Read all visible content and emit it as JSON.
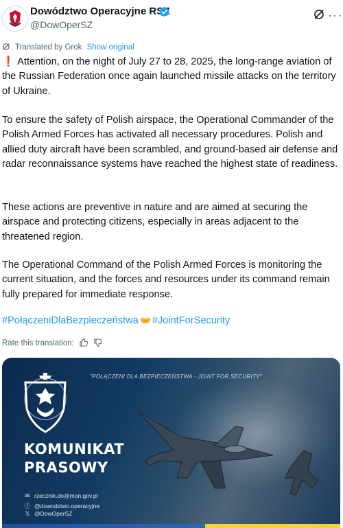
{
  "author": {
    "display_name": "Dowództwo Operacyjne RSZ",
    "handle": "@DowOperSZ"
  },
  "translation": {
    "label": "Translated by Grok",
    "show_original": "Show original"
  },
  "tweet": {
    "paragraphs": [
      "Attention, on the night of July 27 to 28, 2025, the long-range aviation of the Russian Federation once again launched missile attacks on the territory of Ukraine.",
      "To ensure the safety of Polish airspace, the Operational Commander of the Polish Armed Forces has activated all necessary procedures. Polish and allied duty aircraft have been scrambled, and ground-based air defense and radar reconnaissance systems have reached the highest state of readiness.",
      "These actions are preventive in nature and are aimed at securing the airspace and protecting citizens, especially in areas adjacent to the threatened region.",
      "The Operational Command of the Polish Armed Forces is monitoring the current situation, and the forces and resources under its command remain fully prepared for immediate response."
    ],
    "hashtag_1": "#PołączeniDlaBezpieczeństwa",
    "hashtag_2": "#JointForSecurity"
  },
  "rate": {
    "label": "Rate this translation:"
  },
  "media": {
    "slogan": "\"POŁĄCZENI DLA BEZPIECZEŃSTWA - JOINT FOR SECURITY\"",
    "title_line1": "KOMUNIKAT",
    "title_line2": "PRASOWY",
    "contact_email": "rzecznik.do@mon.gov.pl",
    "contact_facebook": "@dowodztwo.operacyjne",
    "contact_x": "@DowOperSZ"
  },
  "colors": {
    "link": "#1d9bf0",
    "alert_mark": "#d6232e",
    "media_background": "#123b63"
  }
}
